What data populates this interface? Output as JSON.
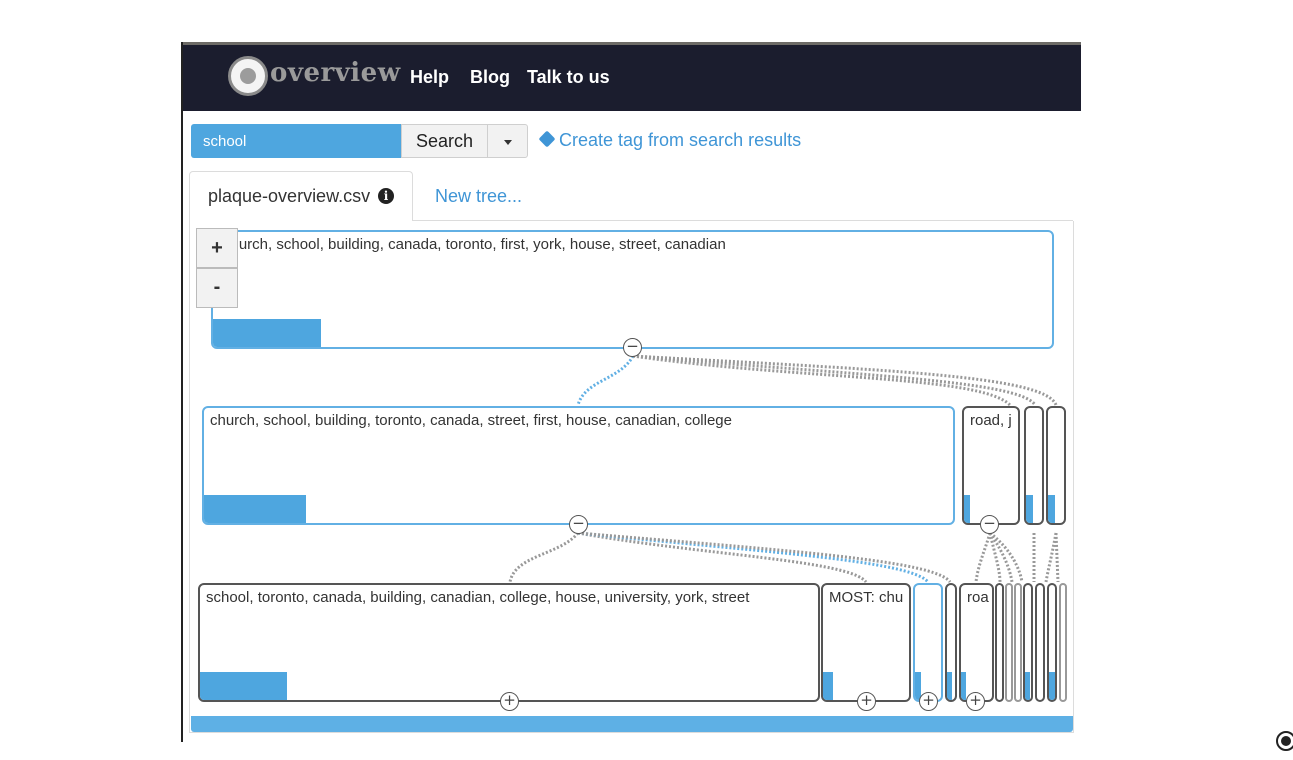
{
  "brand": {
    "logo_text": "overview",
    "logo_icon": "overview-globe-icon"
  },
  "nav": {
    "links": [
      "Help",
      "Blog",
      "Talk to us"
    ]
  },
  "search": {
    "value": "school",
    "button_label": "Search",
    "dropdown_icon": "caret-down-icon"
  },
  "create_tag": {
    "label": "Create tag from search results",
    "icon": "tag-icon"
  },
  "tabs": {
    "active_label": "plaque-overview.csv",
    "info_icon": "info-circle-icon",
    "new_tree_label": "New tree..."
  },
  "zoom": {
    "in_label": "+",
    "out_label": "-"
  },
  "tree": {
    "root": {
      "label": "church, school, building, canada, toronto, first, york, house, street, canadian",
      "fill": 0.13
    },
    "level1": [
      {
        "label": "church, school, building, toronto, canada, street, first, house, canadian, college",
        "fill": 0.14
      },
      {
        "label": "road, j",
        "fill": 0.12
      },
      {
        "label": "",
        "fill": 0.4
      },
      {
        "label": "",
        "fill": 0.4
      }
    ],
    "level2": [
      {
        "label": "school, toronto, canada, building, canadian, college, house, university, york, street",
        "fill": 0.14
      },
      {
        "label": "MOST: chu",
        "fill": 0.12
      },
      {
        "label": "roa",
        "fill": 0.2
      }
    ],
    "expand_symbol": "+",
    "collapse_symbol": "−"
  },
  "colors": {
    "navbar": "#1b1d2e",
    "accent": "#4ea6df",
    "link": "#3f95d6",
    "node_selected_border": "#62b0e4"
  }
}
